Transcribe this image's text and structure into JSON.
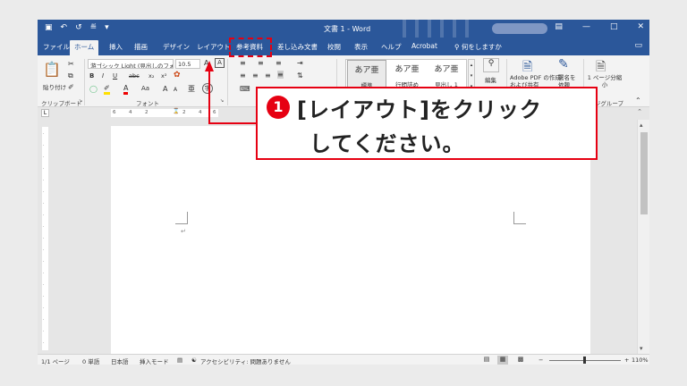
{
  "titlebar": {
    "document_title": "文書 1 - Word",
    "qat_icons": [
      "save-icon",
      "undo-icon",
      "redo-icon",
      "customize-icon"
    ],
    "window_buttons": [
      "ribbon-display-icon",
      "minimize-icon",
      "maximize-icon",
      "close-icon"
    ]
  },
  "tabs": [
    {
      "label": "ファイル"
    },
    {
      "label": "ホーム"
    },
    {
      "label": "挿入"
    },
    {
      "label": "描画"
    },
    {
      "label": "デザイン"
    },
    {
      "label": "レイアウト"
    },
    {
      "label": "参考資料"
    },
    {
      "label": "差し込み文書"
    },
    {
      "label": "校閲"
    },
    {
      "label": "表示"
    },
    {
      "label": "ヘルプ"
    },
    {
      "label": "Acrobat"
    }
  ],
  "tell_me": "何をしますか",
  "ribbon": {
    "clipboard": {
      "paste_label": "貼り付け",
      "group_label": "クリップボード"
    },
    "font": {
      "font_name": "游ゴシック Light (見出しのフォ",
      "font_size": "10.5",
      "bold": "B",
      "italic": "I",
      "underline": "U",
      "strike": "abc",
      "subscript": "x₂",
      "superscript": "x²",
      "font_color_letter": "A",
      "change_case": "Aa",
      "grow": "A",
      "shrink": "A",
      "group_label": "フォント"
    },
    "styles": {
      "items": [
        {
          "preview": "あア亜",
          "name": "標準"
        },
        {
          "preview": "あア亜",
          "name": "行間詰め"
        },
        {
          "preview": "あア亜",
          "name": "見出し 1"
        }
      ]
    },
    "editing": {
      "label": "編集"
    },
    "adobe": {
      "label": "Adobe PDF の作成および共有"
    },
    "sign": {
      "label": "署名を依頼"
    },
    "page1": {
      "label": "1 ページ分縮小"
    },
    "group_end_label": "ページグループ"
  },
  "ruler": {
    "corner": "L",
    "h_ticks": [
      "6",
      "4",
      "2",
      "2",
      "4",
      "6"
    ]
  },
  "document": {
    "para_mark": "↵"
  },
  "status": {
    "page": "1/1 ページ",
    "words": "0 単語",
    "language": "日本語",
    "insert_mode": "挿入モード",
    "accessibility": "アクセシビリティ: 問題ありません",
    "zoom_minus": "−",
    "zoom_plus": "+",
    "zoom": "110%",
    "zoom_level": 0.48
  },
  "annotation": {
    "number": "①",
    "line1": "[レイアウト]をクリック",
    "line2": "してください。",
    "color": "#e60012"
  },
  "colors": {
    "accent": "#2b579a",
    "annotation": "#e60012"
  }
}
